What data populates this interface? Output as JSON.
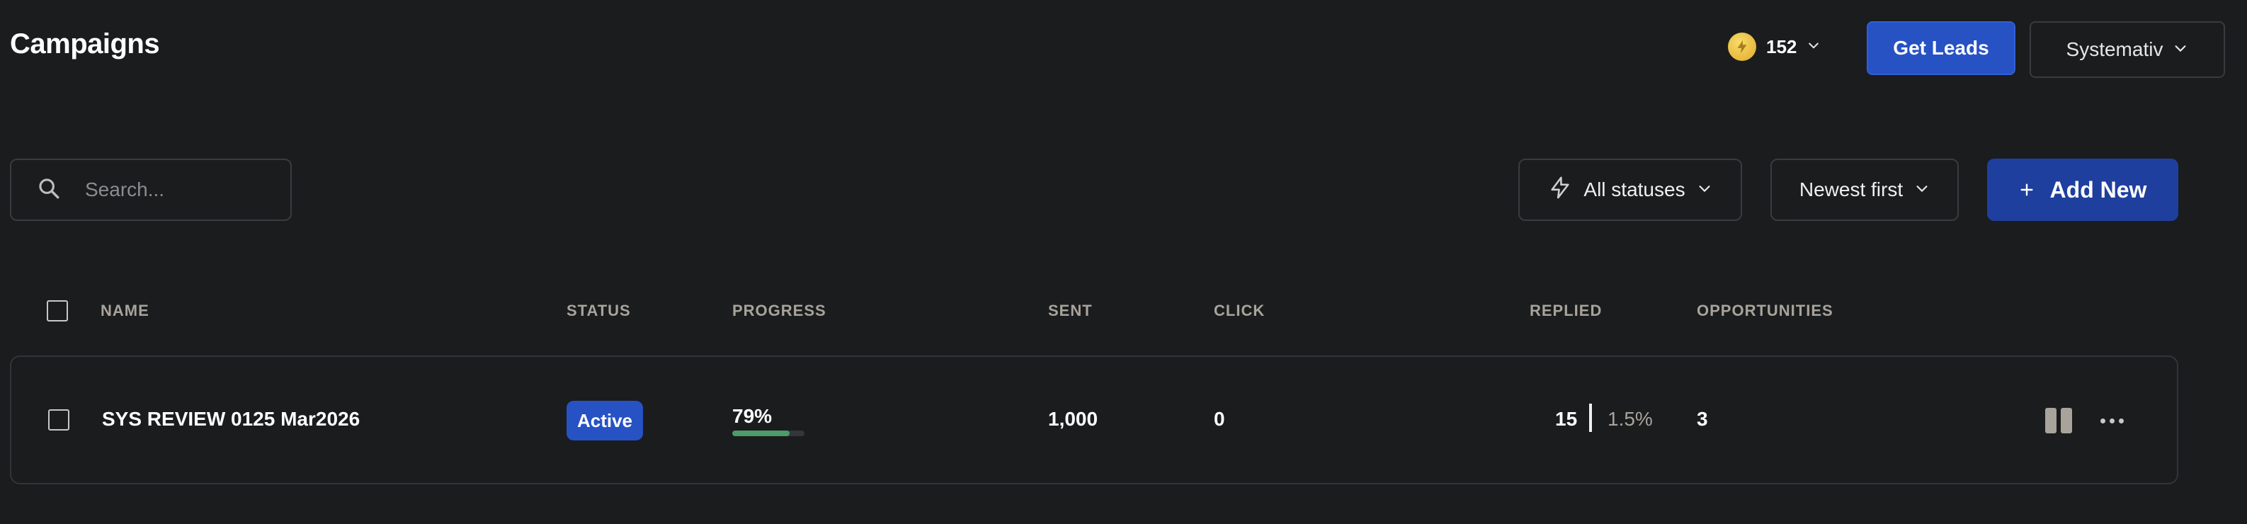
{
  "header": {
    "title": "Campaigns",
    "credits": "152",
    "get_leads_label": "Get Leads",
    "workspace_name": "Systemativ"
  },
  "toolbar": {
    "search_placeholder": "Search...",
    "status_filter_label": "All statuses",
    "sort_label": "Newest first",
    "add_new_label": "Add New"
  },
  "table": {
    "columns": [
      "NAME",
      "STATUS",
      "PROGRESS",
      "SENT",
      "CLICK",
      "REPLIED",
      "OPPORTUNITIES"
    ],
    "rows": [
      {
        "name": "SYS REVIEW 0125 Mar2026",
        "status": "Active",
        "progress_label": "79%",
        "progress_value": 79,
        "sent": "1,000",
        "click": "0",
        "replied": "15",
        "replied_rate": "1.5%",
        "opportunities": "3"
      }
    ]
  },
  "icons": {
    "credits": "lightning-coin-icon",
    "status_filter": "lightning-icon",
    "search": "search-icon",
    "add": "plus-icon",
    "pause": "pause-icon",
    "more": "more-horizontal-icon",
    "dropdown": "chevron-down-icon"
  },
  "colors": {
    "background": "#1b1c1e",
    "primary_button": "#2752c4",
    "add_new_button": "#1f3f9e",
    "active_badge": "#2752c4",
    "progress_fill": "#4c9b6a",
    "muted_text": "#a8a49b"
  }
}
